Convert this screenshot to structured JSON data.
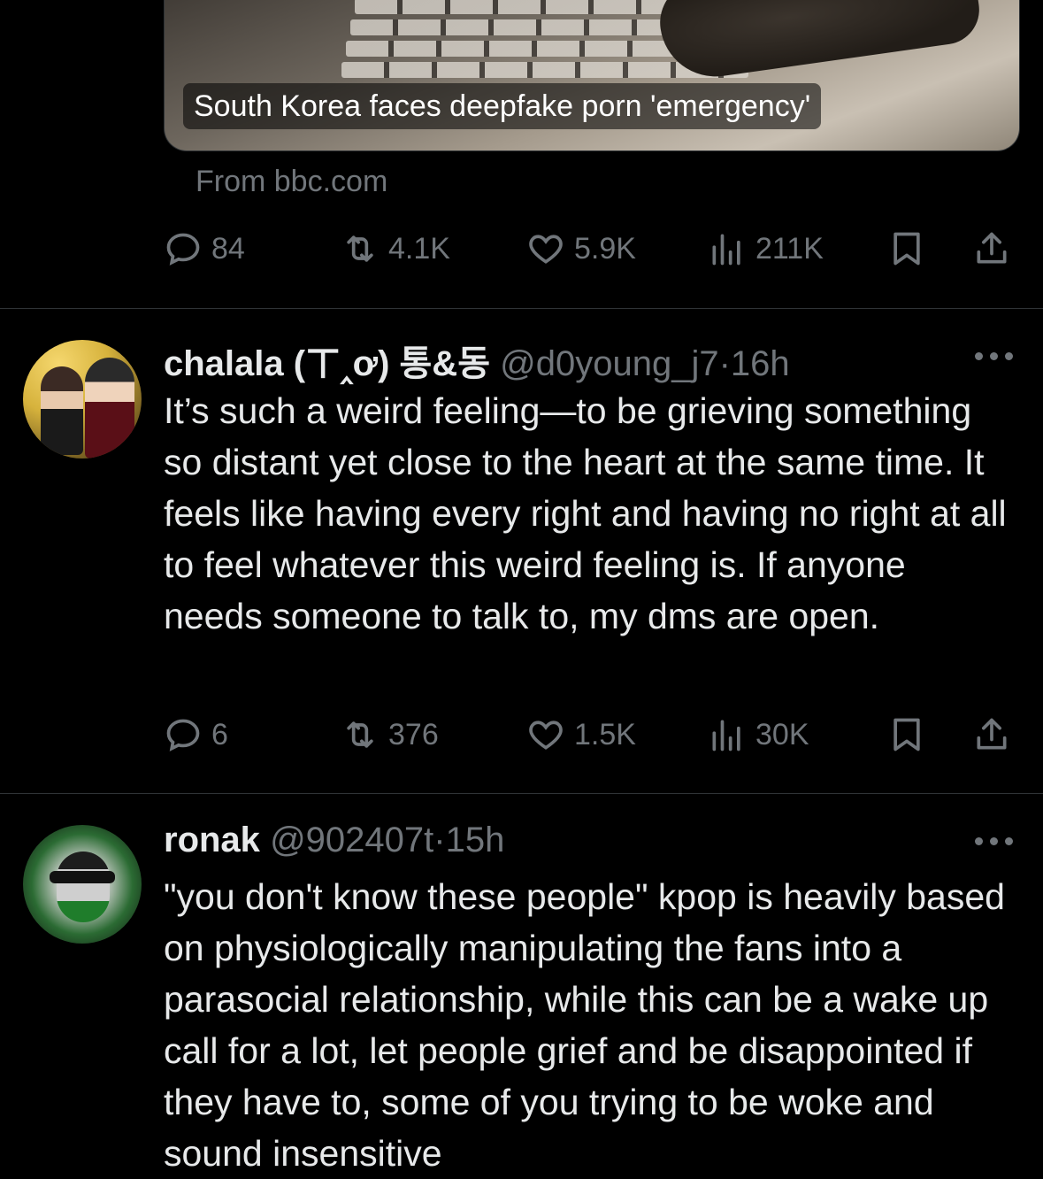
{
  "link_card": {
    "headline": "South Korea faces deepfake porn 'emergency'",
    "source": "From bbc.com"
  },
  "tweets": [
    {
      "counts": {
        "replies": "84",
        "reposts": "4.1K",
        "likes": "5.9K",
        "views": "211K"
      }
    },
    {
      "name": "chalala (ㄒ‸ơ) 통&동",
      "handle": "@d0young_j7",
      "sep": "·",
      "time": "16h",
      "text": "It’s such a weird feeling—to be grieving something so distant yet close to the heart at the same time. It feels like having every right and having no right at all to feel whatever this weird feeling is. If anyone needs someone to talk to, my dms are open.",
      "counts": {
        "replies": "6",
        "reposts": "376",
        "likes": "1.5K",
        "views": "30K"
      }
    },
    {
      "name": "ronak",
      "handle": "@902407t",
      "sep": "·",
      "time": "15h",
      "text": "\"you don't know these people\" kpop is heavily based on physiologically manipulating the fans into a parasocial relationship, while this can be a wake up call for a lot, let people grief and be disappointed if they have to, some of you trying to be woke and sound insensitive"
    }
  ],
  "icons": {
    "reply": "reply-icon",
    "repost": "repost-icon",
    "like": "heart-icon",
    "views": "views-icon",
    "bookmark": "bookmark-icon",
    "share": "share-icon",
    "more": "more-icon"
  },
  "colors": {
    "background": "#000000",
    "text": "#e7e9ea",
    "muted": "#71767b",
    "divider": "#2f3336"
  }
}
